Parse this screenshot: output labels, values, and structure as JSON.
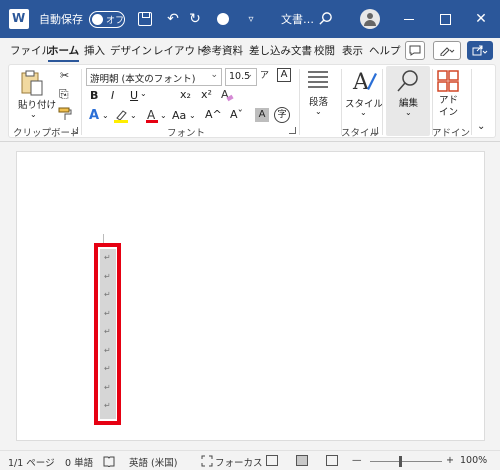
{
  "titlebar": {
    "autosave_label": "自動保存",
    "autosave_state": "オフ",
    "undo_glyph": "↶",
    "redo_glyph": "↻",
    "more_glyph": "▿",
    "doc_title": "文書…",
    "search_icon": "search-icon",
    "close_glyph": "✕"
  },
  "menu": {
    "tabs": [
      "ファイル",
      "ホーム",
      "挿入",
      "デザイン",
      "レイアウト",
      "参考資料",
      "差し込み文書",
      "校閲",
      "表示",
      "ヘルプ"
    ],
    "active_tab": "ホーム",
    "comment_icon": "comment-icon",
    "editing_icon": "pen-icon",
    "share_icon": "share-icon"
  },
  "ribbon": {
    "clipboard": {
      "paste_label": "貼り付け",
      "group_label": "クリップボード"
    },
    "font": {
      "font_name": "游明朝 (本文のフォント)",
      "font_size": "10.5",
      "bold": "B",
      "italic": "I",
      "underline": "U",
      "subscript": "x₂",
      "superscript": "x²",
      "case_label": "Aa",
      "grow_label": "A^",
      "shrink_label": "Aˇ",
      "group_label": "フォント"
    },
    "paragraph": {
      "label": "段落"
    },
    "styles": {
      "label": "スタイル",
      "group_label": "スタイル"
    },
    "editing": {
      "label": "編集"
    },
    "addins": {
      "label": "アド\nイン",
      "group_label": "アドイン"
    }
  },
  "document": {
    "paragraph_mark": "↵",
    "paragraph_count": 9,
    "highlight_color": "#e60012"
  },
  "statusbar": {
    "page": "1/1 ページ",
    "words": "0 単語",
    "language": "英語 (米国)",
    "focus": "フォーカス",
    "zoom_minus": "—",
    "zoom_plus": "+",
    "zoom_level": "100%"
  },
  "colors": {
    "brand": "#2b579a",
    "ribbon_bg": "#f3f3f3",
    "highlight": "#e60012"
  }
}
